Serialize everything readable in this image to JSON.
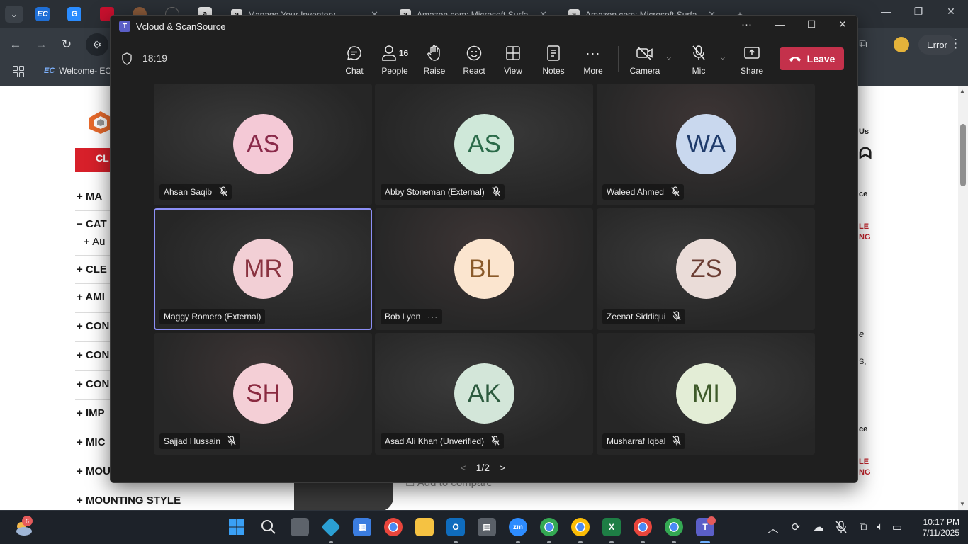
{
  "browser": {
    "tabs": [
      {
        "title": "Manage Your Inventory",
        "favicon": "a"
      },
      {
        "title": "Amazon.com: Microsoft Surfa",
        "favicon": "a"
      },
      {
        "title": "Amazon.com: Microsoft Surfa",
        "favicon": "a"
      }
    ],
    "pinned_favicons": [
      "EC",
      "G",
      "",
      "",
      "",
      "a"
    ],
    "bookmark": "Welcome- EC",
    "error_chip": "Error",
    "page": {
      "categories": [
        "MA",
        "CAT",
        "Au",
        "CLE",
        "AMI",
        "CON",
        "CON",
        "CON",
        "IMP",
        "MIC",
        "MOU",
        "MOUNTING STYLE"
      ],
      "category_signs": [
        "+",
        "−",
        "+",
        "+",
        "+",
        "+",
        "+",
        "+",
        "+",
        "+",
        "+",
        "+"
      ],
      "banner": "CL",
      "right_texts": [
        "Us",
        "ce",
        "LE",
        "NG",
        "e",
        "S,",
        "ce",
        "LE",
        "NG"
      ],
      "add_to_compare": "Add to compare"
    }
  },
  "meeting": {
    "window_title": "Vcloud & ScanSource",
    "timer": "18:19",
    "toolbar": {
      "chat": "Chat",
      "people": "People",
      "people_count": "16",
      "raise": "Raise",
      "react": "React",
      "view": "View",
      "notes": "Notes",
      "more": "More",
      "camera": "Camera",
      "mic": "Mic",
      "share": "Share",
      "leave": "Leave"
    },
    "participants": [
      {
        "initials": "AS",
        "name": "Ahsan Saqib",
        "status": "muted",
        "avatar_bg": "#f4c9d6",
        "avatar_fg": "#8a2a4a"
      },
      {
        "initials": "AS",
        "name": "Abby Stoneman (External)",
        "status": "muted",
        "avatar_bg": "#cfe8d9",
        "avatar_fg": "#2c6b4a"
      },
      {
        "initials": "WA",
        "name": "Waleed Ahmed",
        "status": "muted",
        "avatar_bg": "#c9d8ee",
        "avatar_fg": "#1f3b6b"
      },
      {
        "initials": "MR",
        "name": "Maggy Romero (External)",
        "status": "speaking",
        "avatar_bg": "#f2cfd5",
        "avatar_fg": "#8a3340"
      },
      {
        "initials": "BL",
        "name": "Bob Lyon",
        "status": "more",
        "avatar_bg": "#fbe5cf",
        "avatar_fg": "#8a5a2a"
      },
      {
        "initials": "ZS",
        "name": "Zeenat Siddiqui",
        "status": "muted",
        "avatar_bg": "#eadcd8",
        "avatar_fg": "#6b3d33"
      },
      {
        "initials": "SH",
        "name": "Sajjad Hussain",
        "status": "muted",
        "avatar_bg": "#f4cfd6",
        "avatar_fg": "#8a2a40"
      },
      {
        "initials": "AK",
        "name": "Asad Ali Khan (Unverified)",
        "status": "muted",
        "avatar_bg": "#d3e6d9",
        "avatar_fg": "#2c5a3e"
      },
      {
        "initials": "MI",
        "name": "Musharraf Iqbal",
        "status": "muted",
        "avatar_bg": "#e3edd6",
        "avatar_fg": "#3e5a2a"
      }
    ],
    "pager": "1/2"
  },
  "taskbar": {
    "weather_badge": "6",
    "time": "10:17 PM",
    "date": "7/11/2025"
  }
}
